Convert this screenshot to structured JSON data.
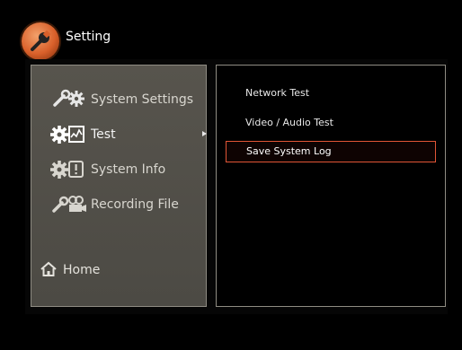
{
  "app": {
    "title": "Setting"
  },
  "sidebar": {
    "items": [
      {
        "label": "System Settings",
        "icon": "wrench-gear-icon"
      },
      {
        "label": "Test",
        "icon": "gear-chart-icon",
        "has_submenu": true
      },
      {
        "label": "System Info",
        "icon": "gear-info-icon"
      },
      {
        "label": "Recording File",
        "icon": "wrench-camera-icon"
      }
    ],
    "home": {
      "label": "Home",
      "icon": "home-icon"
    }
  },
  "submenu": {
    "items": [
      {
        "label": "Network Test",
        "selected": false
      },
      {
        "label": "Video / Audio Test",
        "selected": false
      },
      {
        "label": "Save System Log",
        "selected": true
      }
    ]
  },
  "colors": {
    "accent": "#e05536",
    "panel": "#55524b",
    "border": "#8f8c83",
    "logo": "#d9602a"
  }
}
